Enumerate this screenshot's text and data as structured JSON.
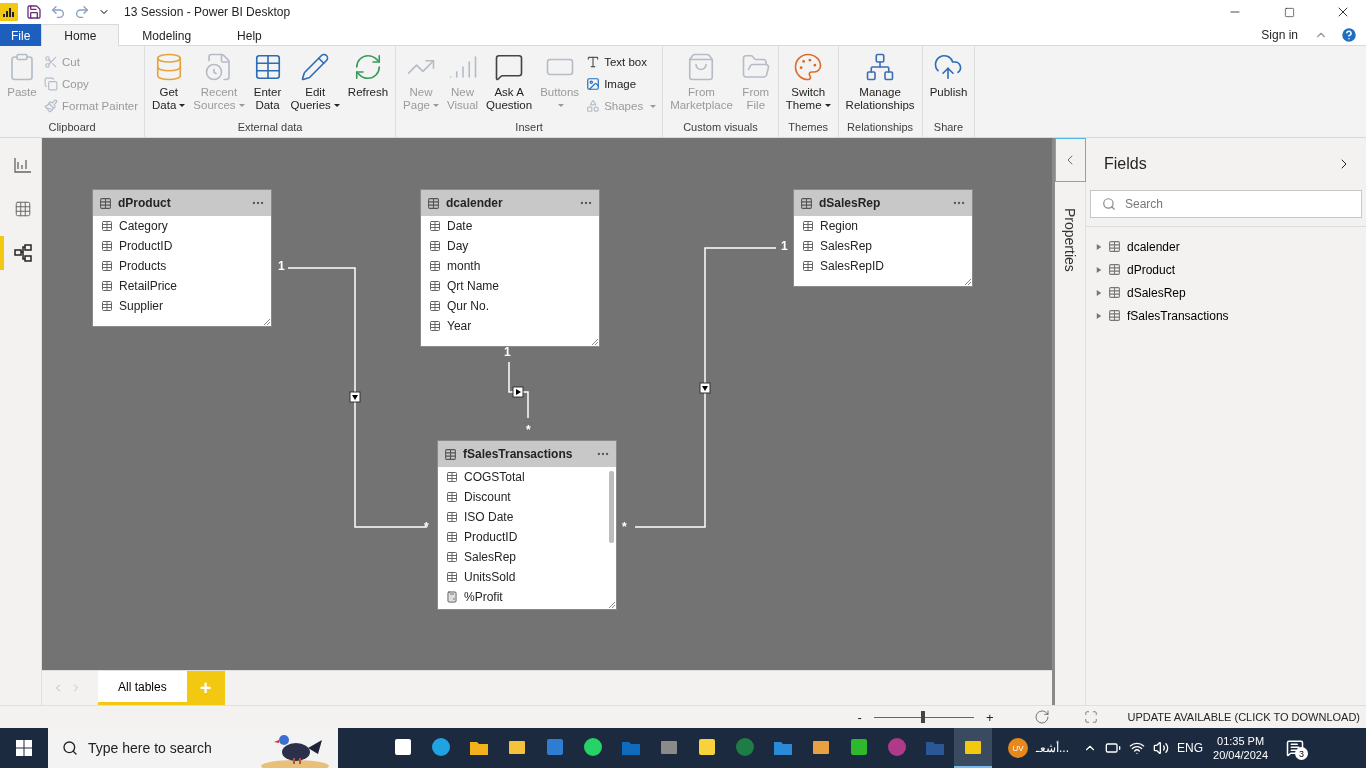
{
  "title_bar": {
    "title": "13 Session - Power BI Desktop"
  },
  "menu_tabs": [
    {
      "label": "File",
      "kind": "file",
      "selected": false
    },
    {
      "label": "Home",
      "kind": "tab",
      "selected": true
    },
    {
      "label": "Modeling",
      "kind": "tab",
      "selected": false
    },
    {
      "label": "Help",
      "kind": "tab",
      "selected": false
    }
  ],
  "account": {
    "sign_in": "Sign in"
  },
  "ribbon": [
    {
      "label": "Clipboard",
      "items": [
        {
          "kind": "large",
          "lines": [
            "Paste"
          ],
          "disabled": true,
          "dropdown": false
        },
        {
          "kind": "small",
          "lines": [
            "Cut"
          ],
          "disabled": true,
          "dropdown": false
        },
        {
          "kind": "small",
          "lines": [
            "Copy"
          ],
          "disabled": true,
          "dropdown": false
        },
        {
          "kind": "small",
          "lines": [
            "Format Painter"
          ],
          "disabled": true,
          "dropdown": false
        }
      ]
    },
    {
      "label": "External data",
      "items": [
        {
          "kind": "large",
          "lines": [
            "Get",
            "Data"
          ],
          "disabled": false,
          "dropdown": true
        },
        {
          "kind": "large",
          "lines": [
            "Recent",
            "Sources"
          ],
          "disabled": true,
          "dropdown": true
        },
        {
          "kind": "large",
          "lines": [
            "Enter",
            "Data"
          ],
          "disabled": false,
          "dropdown": false
        },
        {
          "kind": "large",
          "lines": [
            "Edit",
            "Queries"
          ],
          "disabled": false,
          "dropdown": true
        },
        {
          "kind": "large",
          "lines": [
            "Refresh"
          ],
          "disabled": false,
          "dropdown": false
        }
      ]
    },
    {
      "label": "Insert",
      "items": [
        {
          "kind": "large",
          "lines": [
            "New",
            "Page"
          ],
          "disabled": true,
          "dropdown": true
        },
        {
          "kind": "large",
          "lines": [
            "New",
            "Visual"
          ],
          "disabled": true,
          "dropdown": false
        },
        {
          "kind": "large",
          "lines": [
            "Ask A",
            "Question"
          ],
          "disabled": false,
          "dropdown": false
        },
        {
          "kind": "large",
          "lines": [
            "Buttons"
          ],
          "disabled": true,
          "dropdown": true
        },
        {
          "kind": "small",
          "lines": [
            "Text box"
          ],
          "disabled": false,
          "dropdown": false
        },
        {
          "kind": "small",
          "lines": [
            "Image"
          ],
          "disabled": false,
          "dropdown": false
        },
        {
          "kind": "small",
          "lines": [
            "Shapes"
          ],
          "disabled": true,
          "dropdown": true
        }
      ]
    },
    {
      "label": "Custom visuals",
      "items": [
        {
          "kind": "large",
          "lines": [
            "From",
            "Marketplace"
          ],
          "disabled": true,
          "dropdown": false
        },
        {
          "kind": "large",
          "lines": [
            "From",
            "File"
          ],
          "disabled": true,
          "dropdown": false
        }
      ]
    },
    {
      "label": "Themes",
      "items": [
        {
          "kind": "large",
          "lines": [
            "Switch",
            "Theme"
          ],
          "disabled": false,
          "dropdown": true
        }
      ]
    },
    {
      "label": "Relationships",
      "items": [
        {
          "kind": "large",
          "lines": [
            "Manage",
            "Relationships"
          ],
          "disabled": false,
          "dropdown": false
        }
      ]
    },
    {
      "label": "Share",
      "items": [
        {
          "kind": "large",
          "lines": [
            "Publish"
          ],
          "disabled": false,
          "dropdown": false
        }
      ]
    }
  ],
  "views": [
    {
      "selected": false
    },
    {
      "selected": false
    },
    {
      "selected": true
    }
  ],
  "model_tables": [
    {
      "name": "dProduct",
      "fields": [
        {
          "name": "Category",
          "kind": "column"
        },
        {
          "name": "ProductID",
          "kind": "column"
        },
        {
          "name": "Products",
          "kind": "column"
        },
        {
          "name": "RetailPrice",
          "kind": "column"
        },
        {
          "name": "Supplier",
          "kind": "column"
        }
      ]
    },
    {
      "name": "dcalender",
      "fields": [
        {
          "name": "Date",
          "kind": "column"
        },
        {
          "name": "Day",
          "kind": "column"
        },
        {
          "name": "month",
          "kind": "column"
        },
        {
          "name": "Qrt Name",
          "kind": "column"
        },
        {
          "name": "Qur No.",
          "kind": "column"
        },
        {
          "name": "Year",
          "kind": "column"
        }
      ]
    },
    {
      "name": "dSalesRep",
      "fields": [
        {
          "name": "Region",
          "kind": "column"
        },
        {
          "name": "SalesRep",
          "kind": "column"
        },
        {
          "name": "SalesRepID",
          "kind": "column"
        }
      ]
    },
    {
      "name": "fSalesTransactions",
      "fields": [
        {
          "name": "COGSTotal",
          "kind": "column"
        },
        {
          "name": "Discount",
          "kind": "column"
        },
        {
          "name": "ISO Date",
          "kind": "column"
        },
        {
          "name": "ProductID",
          "kind": "column"
        },
        {
          "name": "SalesRep",
          "kind": "column"
        },
        {
          "name": "UnitsSold",
          "kind": "column"
        },
        {
          "name": "%Profit",
          "kind": "measure"
        }
      ]
    }
  ],
  "relationships": [
    {
      "one": "1",
      "many": "*"
    },
    {
      "one": "1",
      "many": "*"
    },
    {
      "one": "1",
      "many": "*"
    }
  ],
  "page_tabs": [
    {
      "label": "All tables",
      "selected": true
    }
  ],
  "add_page": "+",
  "properties_pane": {
    "label": "Properties"
  },
  "fields_pane": {
    "title": "Fields",
    "search_placeholder": "Search",
    "tables": [
      {
        "name": "dcalender",
        "expanded": false
      },
      {
        "name": "dProduct",
        "expanded": false
      },
      {
        "name": "dSalesRep",
        "expanded": false
      },
      {
        "name": "fSalesTransactions",
        "expanded": false
      }
    ]
  },
  "status_bar": {
    "zoom_out": "-",
    "zoom_in": "+",
    "zoom": {
      "level": 0.49
    },
    "update": "UPDATE AVAILABLE (CLICK TO DOWNLOAD)"
  },
  "taskbar": {
    "search_placeholder": "Type here to search",
    "apps": [
      {
        "selected": false
      },
      {
        "selected": false
      },
      {
        "selected": false
      },
      {
        "selected": false
      },
      {
        "selected": false
      },
      {
        "selected": false
      },
      {
        "selected": false
      },
      {
        "selected": false
      },
      {
        "selected": false
      },
      {
        "selected": false
      },
      {
        "selected": false
      },
      {
        "selected": false
      },
      {
        "selected": false
      },
      {
        "selected": false
      },
      {
        "selected": false
      },
      {
        "selected": true
      }
    ],
    "user_initials": "UV",
    "user_label": "أشعـ...",
    "language": "ENG",
    "time": "01:35 PM",
    "date": "20/04/2024",
    "notifications": "3"
  }
}
